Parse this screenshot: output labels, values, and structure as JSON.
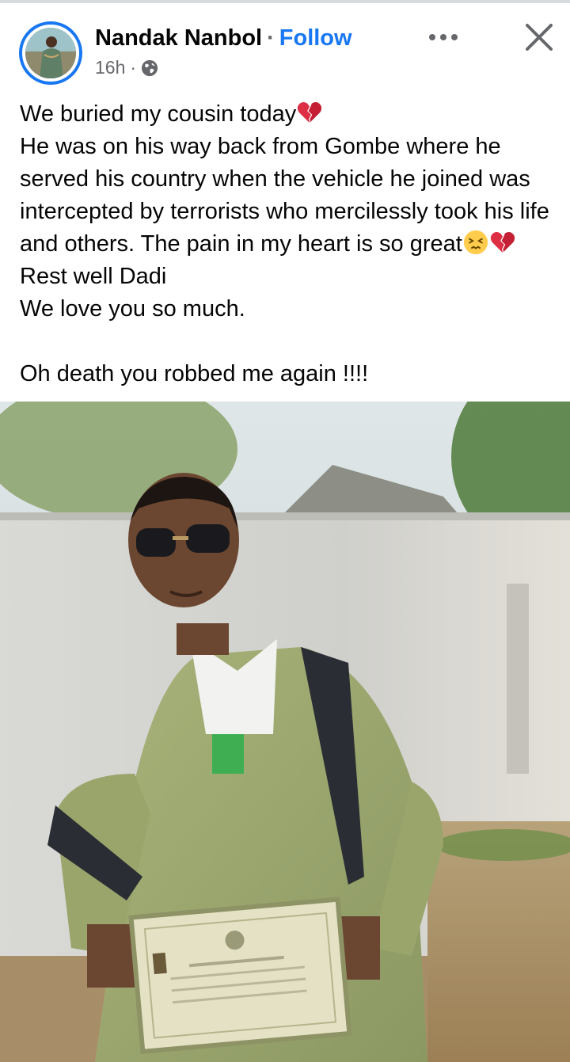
{
  "post": {
    "author": "Nandak Nanbol",
    "separator": "·",
    "follow_label": "Follow",
    "time": "16h",
    "meta_separator": "·",
    "audience_icon": "globe-icon",
    "more_icon": "more-options-icon",
    "close_icon": "close-icon",
    "lines": {
      "l1": "We buried my cousin today",
      "l2": "He was on his way back from Gombe where he served his country when the vehicle he joined was intercepted by terrorists who mercilessly took his life and others. The pain in my heart is so great",
      "l2b": " Rest well Dadi",
      "l3": "We love you so much.",
      "l4": "Oh death you robbed me again !!!!"
    },
    "emojis": [
      "broken-heart-icon",
      "persevering-face-icon",
      "broken-heart-icon"
    ]
  },
  "colors": {
    "accent": "#1877f2",
    "text": "#050505",
    "secondary": "#65676b"
  }
}
